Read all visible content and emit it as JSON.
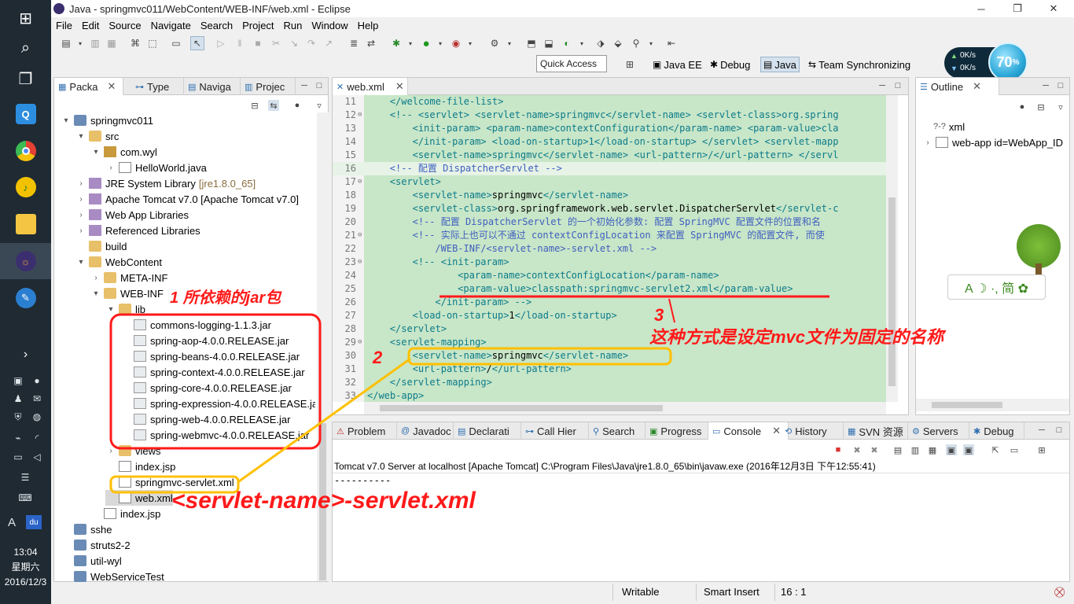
{
  "window": {
    "title": "Java - springmvc011/WebContent/WEB-INF/web.xml - Eclipse"
  },
  "menu": [
    "File",
    "Edit",
    "Source",
    "Navigate",
    "Search",
    "Project",
    "Run",
    "Window",
    "Help"
  ],
  "toolbar": {
    "quick_access": "Quick Access",
    "perspectives": [
      "Java EE",
      "Debug",
      "Java",
      "Team Synchronizing"
    ]
  },
  "widget": {
    "up_speed": "0K/s",
    "down_speed": "0K/s",
    "percent": "70",
    "percent_sign": "%",
    "ime_text": "A ☽ ·, 简 ✿"
  },
  "left_views": {
    "tabs": [
      "Packa",
      "Type",
      "Naviga",
      "Projec"
    ]
  },
  "tree": [
    {
      "label": "springmvc011",
      "depth": 0,
      "arrow": "▾",
      "icon": "proj"
    },
    {
      "label": "src",
      "depth": 1,
      "arrow": "▾",
      "icon": "folder"
    },
    {
      "label": "com.wyl",
      "depth": 2,
      "arrow": "▾",
      "icon": "pkg"
    },
    {
      "label": "HelloWorld.java",
      "depth": 3,
      "arrow": "›",
      "icon": "file"
    },
    {
      "label": "JRE System Library",
      "extra": "[jre1.8.0_65]",
      "depth": 1,
      "arrow": "›",
      "icon": "lib"
    },
    {
      "label": "Apache Tomcat v7.0 [Apache Tomcat v7.0]",
      "depth": 1,
      "arrow": "›",
      "icon": "lib"
    },
    {
      "label": "Web App Libraries",
      "depth": 1,
      "arrow": "›",
      "icon": "lib"
    },
    {
      "label": "Referenced Libraries",
      "depth": 1,
      "arrow": "›",
      "icon": "lib"
    },
    {
      "label": "build",
      "depth": 1,
      "arrow": "",
      "icon": "folder"
    },
    {
      "label": "WebContent",
      "depth": 1,
      "arrow": "▾",
      "icon": "folder"
    },
    {
      "label": "META-INF",
      "depth": 2,
      "arrow": "›",
      "icon": "folder"
    },
    {
      "label": "WEB-INF",
      "depth": 2,
      "arrow": "▾",
      "icon": "folder"
    },
    {
      "label": "lib",
      "depth": 3,
      "arrow": "▾",
      "icon": "folder"
    },
    {
      "label": "commons-logging-1.1.3.jar",
      "depth": 4,
      "arrow": "",
      "icon": "jar"
    },
    {
      "label": "spring-aop-4.0.0.RELEASE.jar",
      "depth": 4,
      "arrow": "",
      "icon": "jar"
    },
    {
      "label": "spring-beans-4.0.0.RELEASE.jar",
      "depth": 4,
      "arrow": "",
      "icon": "jar"
    },
    {
      "label": "spring-context-4.0.0.RELEASE.jar",
      "depth": 4,
      "arrow": "",
      "icon": "jar"
    },
    {
      "label": "spring-core-4.0.0.RELEASE.jar",
      "depth": 4,
      "arrow": "",
      "icon": "jar"
    },
    {
      "label": "spring-expression-4.0.0.RELEASE.jar",
      "depth": 4,
      "arrow": "",
      "icon": "jar"
    },
    {
      "label": "spring-web-4.0.0.RELEASE.jar",
      "depth": 4,
      "arrow": "",
      "icon": "jar"
    },
    {
      "label": "spring-webmvc-4.0.0.RELEASE.jar",
      "depth": 4,
      "arrow": "",
      "icon": "jar"
    },
    {
      "label": "views",
      "depth": 3,
      "arrow": "›",
      "icon": "folder"
    },
    {
      "label": "index.jsp",
      "depth": 3,
      "arrow": "",
      "icon": "file"
    },
    {
      "label": "springmvc-servlet.xml",
      "depth": 3,
      "arrow": "",
      "icon": "file"
    },
    {
      "label": "web.xml",
      "depth": 3,
      "arrow": "",
      "icon": "file",
      "selected": true
    },
    {
      "label": "index.jsp",
      "depth": 2,
      "arrow": "",
      "icon": "file"
    },
    {
      "label": "sshe",
      "depth": 0,
      "arrow": "",
      "icon": "proj"
    },
    {
      "label": "struts2-2",
      "depth": 0,
      "arrow": "",
      "icon": "proj"
    },
    {
      "label": "util-wyl",
      "depth": 0,
      "arrow": "",
      "icon": "proj"
    },
    {
      "label": "WebServiceTest",
      "depth": 0,
      "arrow": "",
      "icon": "proj"
    }
  ],
  "editor": {
    "tab": "web.xml",
    "lines": [
      {
        "n": "11",
        "fold": "",
        "indent": 4,
        "parts": [
          [
            "tag",
            "</welcome-file-list>"
          ]
        ]
      },
      {
        "n": "12",
        "fold": "⊖",
        "indent": 4,
        "parts": [
          [
            "tag",
            "<!-- <servlet> <servlet-name>springmvc</servlet-name> <servlet-class>org.spring"
          ]
        ]
      },
      {
        "n": "13",
        "fold": "",
        "indent": 8,
        "parts": [
          [
            "tag",
            "<init-param> <param-name>contextConfiguration</param-name> <param-value>cla"
          ]
        ]
      },
      {
        "n": "14",
        "fold": "",
        "indent": 8,
        "parts": [
          [
            "tag",
            "</init-param> <load-on-startup>1</load-on-startup> </servlet> <servlet-mapp"
          ]
        ]
      },
      {
        "n": "15",
        "fold": "",
        "indent": 8,
        "parts": [
          [
            "tag",
            "<servlet-name>springmvc</servlet-name> <url-pattern>/</url-pattern> </servl"
          ]
        ]
      },
      {
        "n": "16",
        "fold": "",
        "indent": 4,
        "parts": [
          [
            "com",
            "<!-- 配置 DispatcherServlet -->"
          ]
        ],
        "current": true
      },
      {
        "n": "17",
        "fold": "⊖",
        "indent": 4,
        "parts": [
          [
            "tag",
            "<servlet>"
          ]
        ]
      },
      {
        "n": "18",
        "fold": "",
        "indent": 8,
        "parts": [
          [
            "tag",
            "<servlet-name>"
          ],
          [
            "txt",
            "springmvc"
          ],
          [
            "tag",
            "</servlet-name>"
          ]
        ]
      },
      {
        "n": "19",
        "fold": "",
        "indent": 8,
        "parts": [
          [
            "tag",
            "<servlet-class>"
          ],
          [
            "txt",
            "org.springframework.web.servlet.DispatcherServlet"
          ],
          [
            "tag",
            "</servlet-c"
          ]
        ]
      },
      {
        "n": "20",
        "fold": "",
        "indent": 8,
        "parts": [
          [
            "com",
            "<!-- 配置 DispatcherServlet 的一个初始化参数: 配置 SpringMVC 配置文件的位置和名"
          ]
        ]
      },
      {
        "n": "21",
        "fold": "⊖",
        "indent": 8,
        "parts": [
          [
            "com",
            "<!-- 实际上也可以不通过 contextConfigLocation 来配置 SpringMVC 的配置文件, 而使"
          ]
        ]
      },
      {
        "n": "22",
        "fold": "",
        "indent": 12,
        "parts": [
          [
            "com",
            "/WEB-INF/<servlet-name>-servlet.xml -->"
          ]
        ]
      },
      {
        "n": "23",
        "fold": "⊖",
        "indent": 8,
        "parts": [
          [
            "tag",
            "<!-- <init-param>"
          ]
        ]
      },
      {
        "n": "24",
        "fold": "",
        "indent": 16,
        "parts": [
          [
            "tag",
            "<param-name>contextConfigLocation</param-name>"
          ]
        ]
      },
      {
        "n": "25",
        "fold": "",
        "indent": 16,
        "parts": [
          [
            "tag",
            "<param-value>classpath:springmvc-servlet2.xml</param-value>"
          ]
        ]
      },
      {
        "n": "26",
        "fold": "",
        "indent": 12,
        "parts": [
          [
            "tag",
            "</init-param> -->"
          ]
        ]
      },
      {
        "n": "27",
        "fold": "",
        "indent": 8,
        "parts": [
          [
            "tag",
            "<load-on-startup>"
          ],
          [
            "txt",
            "1"
          ],
          [
            "tag",
            "</load-on-startup>"
          ]
        ]
      },
      {
        "n": "28",
        "fold": "",
        "indent": 4,
        "parts": [
          [
            "tag",
            "</servlet>"
          ]
        ]
      },
      {
        "n": "29",
        "fold": "⊖",
        "indent": 4,
        "parts": [
          [
            "tag",
            "<servlet-mapping>"
          ]
        ]
      },
      {
        "n": "30",
        "fold": "",
        "indent": 8,
        "parts": [
          [
            "tag",
            "<servlet-name>"
          ],
          [
            "txt",
            "springmvc"
          ],
          [
            "tag",
            "</servlet-name>"
          ]
        ]
      },
      {
        "n": "31",
        "fold": "",
        "indent": 8,
        "parts": [
          [
            "tag",
            "<url-pattern>"
          ],
          [
            "txt",
            "/"
          ],
          [
            "tag",
            "</url-pattern>"
          ]
        ]
      },
      {
        "n": "32",
        "fold": "",
        "indent": 4,
        "parts": [
          [
            "tag",
            "</servlet-mapping>"
          ]
        ]
      },
      {
        "n": "33",
        "fold": "",
        "indent": 0,
        "parts": [
          [
            "tag",
            "</web-app>"
          ]
        ]
      }
    ]
  },
  "outline": {
    "tab": "Outline",
    "items": [
      "xml",
      "web-app id=WebApp_ID"
    ],
    "item_prefix": "?-?"
  },
  "console": {
    "tabs": [
      "Problem",
      "Javadoc",
      "Declarati",
      "Call Hier",
      "Search",
      "Progress",
      "Console",
      "History",
      "SVN 资源",
      "Servers",
      "Debug"
    ],
    "header": "Tomcat v7.0 Server at localhost [Apache Tomcat] C:\\Program Files\\Java\\jre1.8.0_65\\bin\\javaw.exe (2016年12月3日 下午12:55:41)",
    "output": "----------"
  },
  "status": {
    "writable": "Writable",
    "insert": "Smart Insert",
    "position": "16 : 1"
  },
  "clock": {
    "time": "13:04",
    "day": "星期六",
    "date": "2016/12/3"
  },
  "annotations": {
    "a1": "1 所依赖的jar包",
    "a2": "2",
    "a3": "3",
    "a3_text": "这种方式是设定mvc文件为固定的名称",
    "servlet_name": "<servlet-name>-servlet.xml"
  },
  "colors": {
    "annotation_red": "#ff1a1a",
    "annotation_yellow": "#ffc000",
    "editor_bg": "#c8e6c8",
    "taskbar": "#1f2a33"
  }
}
